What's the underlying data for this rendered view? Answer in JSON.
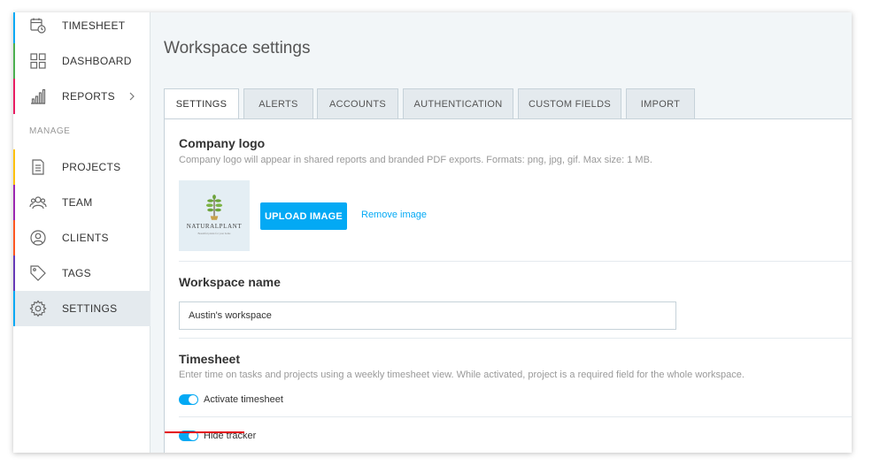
{
  "sidebar": {
    "items": [
      {
        "label": "TIMESHEET",
        "icon": "calendar-clock-icon",
        "accent": "#03a9f4"
      },
      {
        "label": "DASHBOARD",
        "icon": "grid-icon",
        "accent": "#4caf50"
      },
      {
        "label": "REPORTS",
        "icon": "bar-chart-icon",
        "accent": "#e91e63"
      },
      {
        "label": "PROJECTS",
        "icon": "document-icon",
        "accent": "#ffc107"
      },
      {
        "label": "TEAM",
        "icon": "people-icon",
        "accent": "#9c27b0"
      },
      {
        "label": "CLIENTS",
        "icon": "client-icon",
        "accent": "#ff5722"
      },
      {
        "label": "TAGS",
        "icon": "tag-icon",
        "accent": "#673ab7"
      },
      {
        "label": "SETTINGS",
        "icon": "gear-icon",
        "accent": "#03a9f4"
      }
    ],
    "section_manage": "MANAGE"
  },
  "main": {
    "title": "Workspace settings",
    "tabs": [
      {
        "label": "SETTINGS",
        "active": true
      },
      {
        "label": "ALERTS"
      },
      {
        "label": "ACCOUNTS"
      },
      {
        "label": "AUTHENTICATION"
      },
      {
        "label": "CUSTOM FIELDS"
      },
      {
        "label": "IMPORT"
      }
    ]
  },
  "company_logo": {
    "title": "Company logo",
    "description": "Company logo will appear in shared reports and branded PDF exports. Formats: png, jpg, gif. Max size: 1 MB.",
    "logo_text": "NATURALPLANT",
    "logo_tagline": "Beautiful plants for your home",
    "upload_label": "UPLOAD IMAGE",
    "remove_label": "Remove image"
  },
  "workspace_name": {
    "title": "Workspace name",
    "value": "Austin's workspace"
  },
  "timesheet": {
    "title": "Timesheet",
    "description": "Enter time on tasks and projects using a weekly timesheet view. While activated, project is a required field for the whole workspace.",
    "activate_label": "Activate timesheet",
    "activate_on": true,
    "hide_tracker_label": "Hide tracker",
    "hide_tracker_on": true
  },
  "colors": {
    "accent": "#03a9f4",
    "highlight": "#e3000b"
  }
}
